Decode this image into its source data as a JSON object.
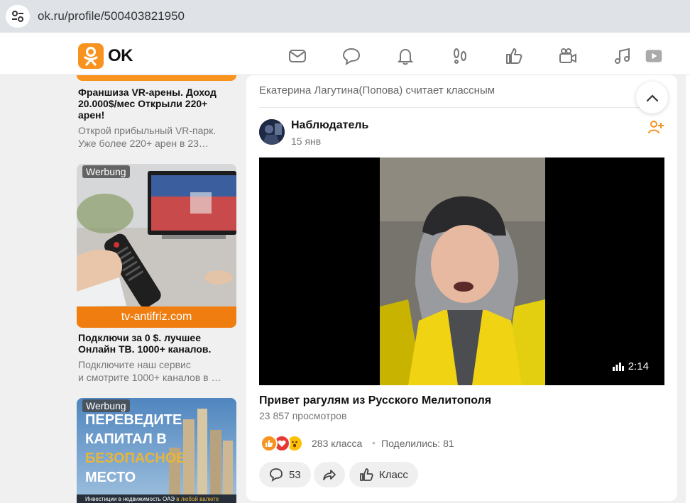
{
  "browser": {
    "url": "ok.ru/profile/500403821950"
  },
  "header": {
    "logo_text": "OK",
    "accent": "#f7931e"
  },
  "nav_icons": [
    "mail-icon",
    "chat-icon",
    "bell-icon",
    "footprints-icon",
    "like-icon",
    "video-camera-icon",
    "music-icon",
    "video-play-icon"
  ],
  "ads": [
    {
      "title": "Франшиза VR-арены. Доход 20.000$/мес Открыли 220+ арен!",
      "desc_line1": "Открой прибыльный VR-парк.",
      "desc_line2": "Уже более 220+ арен в 23…"
    },
    {
      "badge": "Werbung",
      "domain": "tv-antifriz.com",
      "title": "Подключи за 0 $. лучшее Онлайн ТВ. 1000+ каналов.",
      "desc_line1": "Подключите наш сервис",
      "desc_line2": "и смотрите 1000+ каналов в …"
    },
    {
      "badge": "Werbung",
      "image_text_1": "ПЕРЕВЕДИТЕ",
      "image_text_2": "КАПИТАЛ В",
      "image_text_3": "БЕЗОПАСНОЕ",
      "image_text_4": "МЕСТО",
      "image_footer_a": "Инвестиции в недвижимость ОАЭ ",
      "image_footer_b": "в любой валюте"
    }
  ],
  "post": {
    "activity": "Екатерина Лагутина(Попова) считает классным",
    "author": "Наблюдатель",
    "date": "15 янв",
    "duration": "2:14",
    "title": "Привет рагулям из Русского Мелитополя",
    "views": "23 857 просмотров",
    "likes": "283 класса",
    "separator": "•",
    "shares": "Поделились: 81",
    "comments_count": "53",
    "klass_label": "Класс"
  }
}
